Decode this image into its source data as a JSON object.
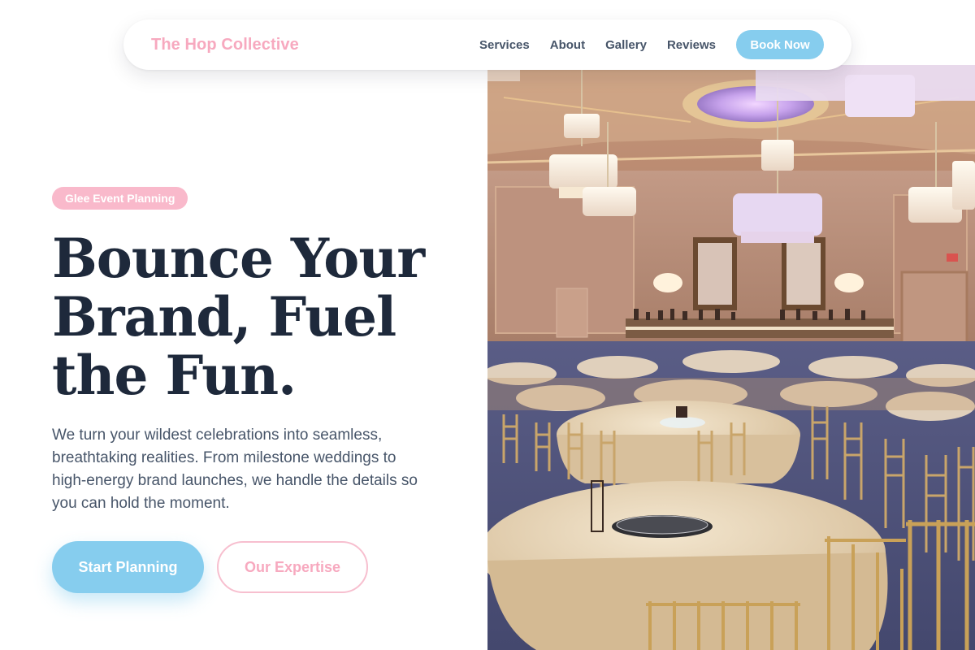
{
  "navbar": {
    "brand": "The Hop Collective",
    "links": [
      "Services",
      "About",
      "Gallery",
      "Reviews"
    ],
    "cta": "Book Now"
  },
  "hero": {
    "badge": "Glee Event Planning",
    "headline_lines": [
      "Bounce Your",
      "Brand, Fuel",
      "the Fun."
    ],
    "intro": "We turn your wildest celebrations into seamless, breathtaking realities. From milestone weddings to high-energy brand launches, we handle the details so you can hold the moment.",
    "primary_button": "Start Planning",
    "secondary_button": "Our Expertise",
    "image_alt": "Banquet hall with chandeliers and round tables"
  },
  "colors": {
    "brand_pink": "#f7a9bf",
    "badge_pink": "#f9b9cb",
    "accent_blue": "#86cdee",
    "heading": "#1e293b",
    "body_text": "#475569"
  }
}
